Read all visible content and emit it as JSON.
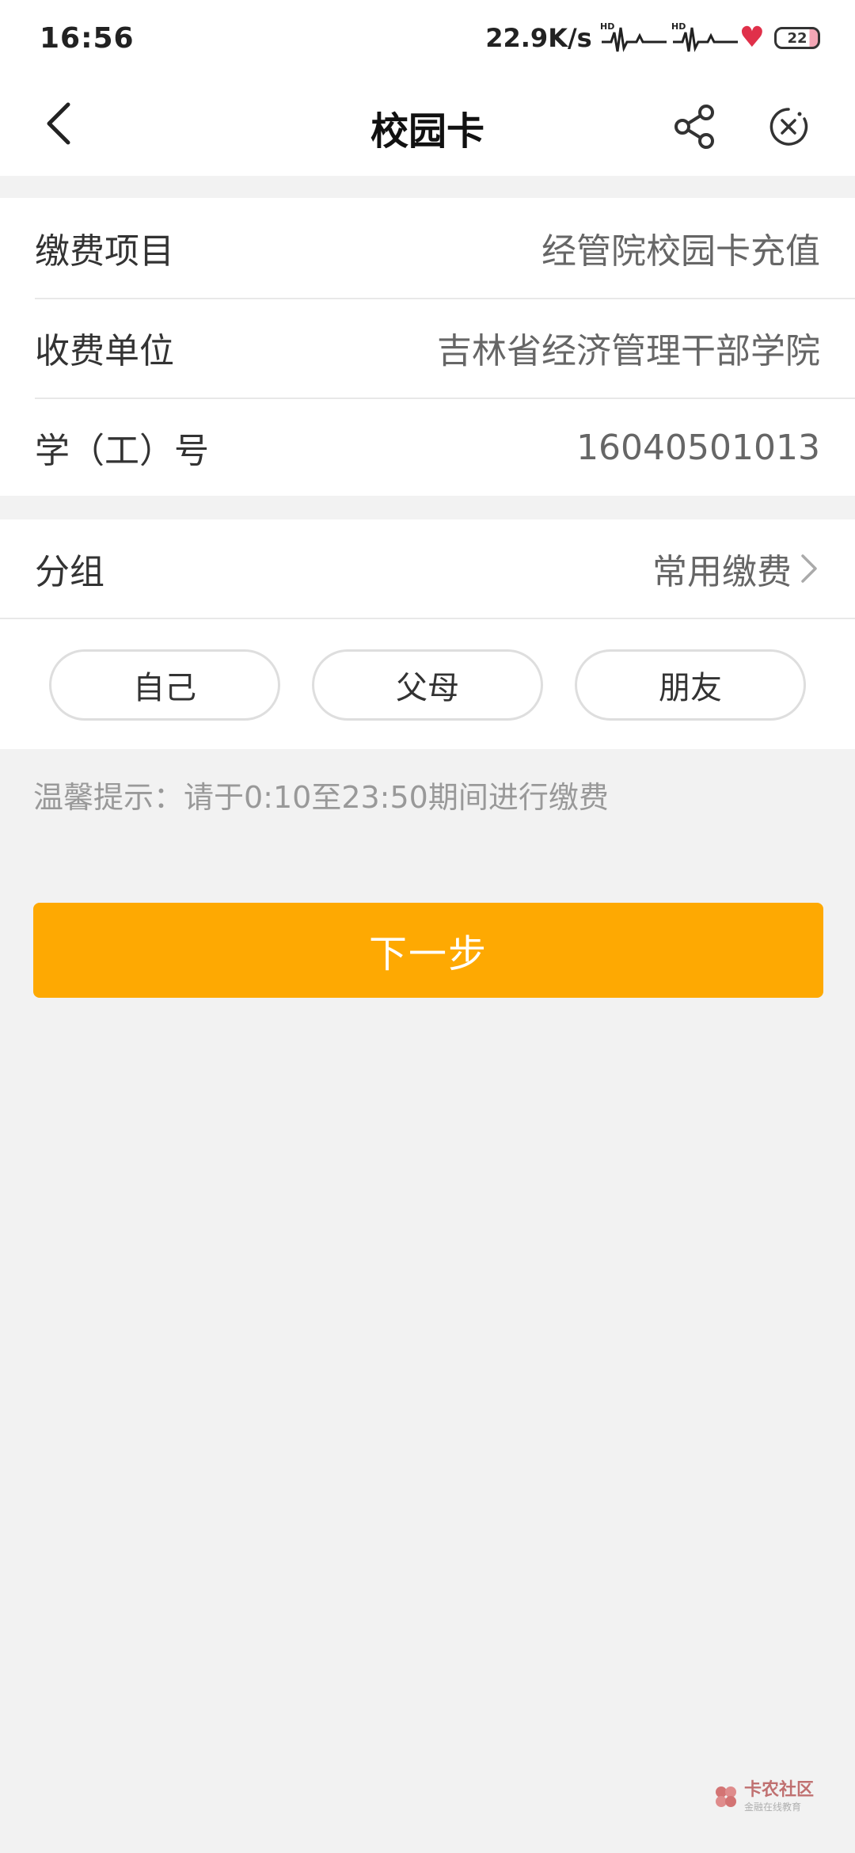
{
  "status_bar": {
    "time": "16:56",
    "net_speed": "22.9K/s",
    "battery": "22",
    "icons": [
      "signal-hd-icon",
      "signal-hd-icon",
      "heart-icon",
      "battery-icon"
    ]
  },
  "header": {
    "title": "校园卡",
    "icons": [
      "back-arrow-icon",
      "share-icon",
      "close-circle-icon"
    ]
  },
  "info": {
    "rows": [
      {
        "label": "缴费项目",
        "value": "经管院校园卡充值"
      },
      {
        "label": "收费单位",
        "value": "吉林省经济管理干部学院"
      },
      {
        "label": "学（工）号",
        "value": "16040501013"
      }
    ]
  },
  "group": {
    "label": "分组",
    "value": "常用缴费",
    "chips": [
      "自己",
      "父母",
      "朋友"
    ]
  },
  "tip": "温馨提示：请于0:10至23:50期间进行缴费",
  "next_button": "下一步",
  "watermark": {
    "title": "卡农社区",
    "subtitle": "金融在线教育"
  },
  "colors": {
    "accent": "#fea902",
    "background": "#f2f2f2",
    "card": "#ffffff"
  }
}
